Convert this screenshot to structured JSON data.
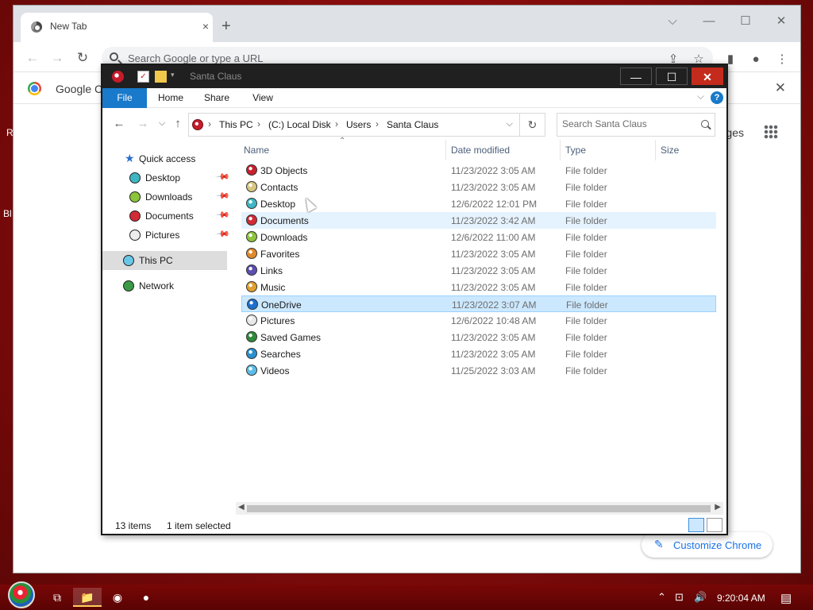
{
  "chrome": {
    "tab_title": "New Tab",
    "tab_close": "×",
    "new_tab": "+",
    "minimize": "—",
    "maximize": "☐",
    "close": "✕",
    "back": "←",
    "forward": "→",
    "reload": "↻",
    "omnibox_placeholder": "Search Google or type a URL",
    "bookmark_label": "Google Cl",
    "bookmark_close": "✕",
    "images_link": "ges",
    "customize_label": "Customize Chrome",
    "customize_icon": "pencil-icon",
    "colors": {
      "tabbar": "#dee1e6",
      "accent": "#1a73e8"
    }
  },
  "desktop": {
    "edge_text_1": "R",
    "edge_text_2": "Bl",
    "background": "#8a0c0c"
  },
  "explorer": {
    "title": "Santa Claus",
    "buttons": {
      "minimize": "—",
      "maximize": "☐",
      "close": "✕"
    },
    "ribbon_tabs": [
      "File",
      "Home",
      "Share",
      "View"
    ],
    "help": "?",
    "ribbon_collapse": "⌵",
    "nav": {
      "back": "←",
      "forward": "→",
      "recent": "⌵",
      "up": "↑"
    },
    "breadcrumb": [
      "This PC",
      "(C:) Local Disk",
      "Users",
      "Santa Claus"
    ],
    "breadcrumb_sep": "›",
    "address_dropdown": "⌵",
    "refresh": "↻",
    "search_placeholder": "Search Santa Claus",
    "nav_pane": {
      "quick_access": "Quick access",
      "quick_items": [
        {
          "label": "Desktop",
          "icon": "ornament-teal-icon"
        },
        {
          "label": "Downloads",
          "icon": "ornament-green-icon"
        },
        {
          "label": "Documents",
          "icon": "ornament-red-icon"
        },
        {
          "label": "Pictures",
          "icon": "ornament-white-icon"
        }
      ],
      "this_pc": "This PC",
      "network": "Network"
    },
    "columns": [
      "Name",
      "Date modified",
      "Type",
      "Size"
    ],
    "rows": [
      {
        "name": "3D Objects",
        "date": "11/23/2022 3:05 AM",
        "type": "File folder",
        "color": "#c8202e"
      },
      {
        "name": "Contacts",
        "date": "11/23/2022 3:05 AM",
        "type": "File folder",
        "color": "#d8c680"
      },
      {
        "name": "Desktop",
        "date": "12/6/2022 12:01 PM",
        "type": "File folder",
        "color": "#3fb6c4"
      },
      {
        "name": "Documents",
        "date": "11/23/2022 3:42 AM",
        "type": "File folder",
        "color": "#d22a36"
      },
      {
        "name": "Downloads",
        "date": "12/6/2022 11:00 AM",
        "type": "File folder",
        "color": "#8cc43c"
      },
      {
        "name": "Favorites",
        "date": "11/23/2022 3:05 AM",
        "type": "File folder",
        "color": "#e08a2a"
      },
      {
        "name": "Links",
        "date": "11/23/2022 3:05 AM",
        "type": "File folder",
        "color": "#5b4fb0"
      },
      {
        "name": "Music",
        "date": "11/23/2022 3:05 AM",
        "type": "File folder",
        "color": "#e0a030"
      },
      {
        "name": "OneDrive",
        "date": "11/23/2022 3:07 AM",
        "type": "File folder",
        "color": "#1c6fd1"
      },
      {
        "name": "Pictures",
        "date": "12/6/2022 10:48 AM",
        "type": "File folder",
        "color": "#e8e8e8"
      },
      {
        "name": "Saved Games",
        "date": "11/23/2022 3:05 AM",
        "type": "File folder",
        "color": "#2f8a3a"
      },
      {
        "name": "Searches",
        "date": "11/23/2022 3:05 AM",
        "type": "File folder",
        "color": "#2a8fcf"
      },
      {
        "name": "Videos",
        "date": "11/25/2022 3:03 AM",
        "type": "File folder",
        "color": "#5bbde8"
      }
    ],
    "hovered_row": "Documents",
    "selected_row": "OneDrive",
    "status": {
      "count": "13 items",
      "selection": "1 item selected"
    },
    "colors": {
      "file_tab": "#1979ca",
      "selection": "#cce8ff",
      "hover": "#e5f3ff"
    }
  },
  "taskbar": {
    "task_view": "⧉",
    "file_explorer": "📁",
    "clock": "9:20:04 AM",
    "tray_chevron": "⌃",
    "network": "⊡",
    "volume": "🔊",
    "notifications": "▤"
  }
}
